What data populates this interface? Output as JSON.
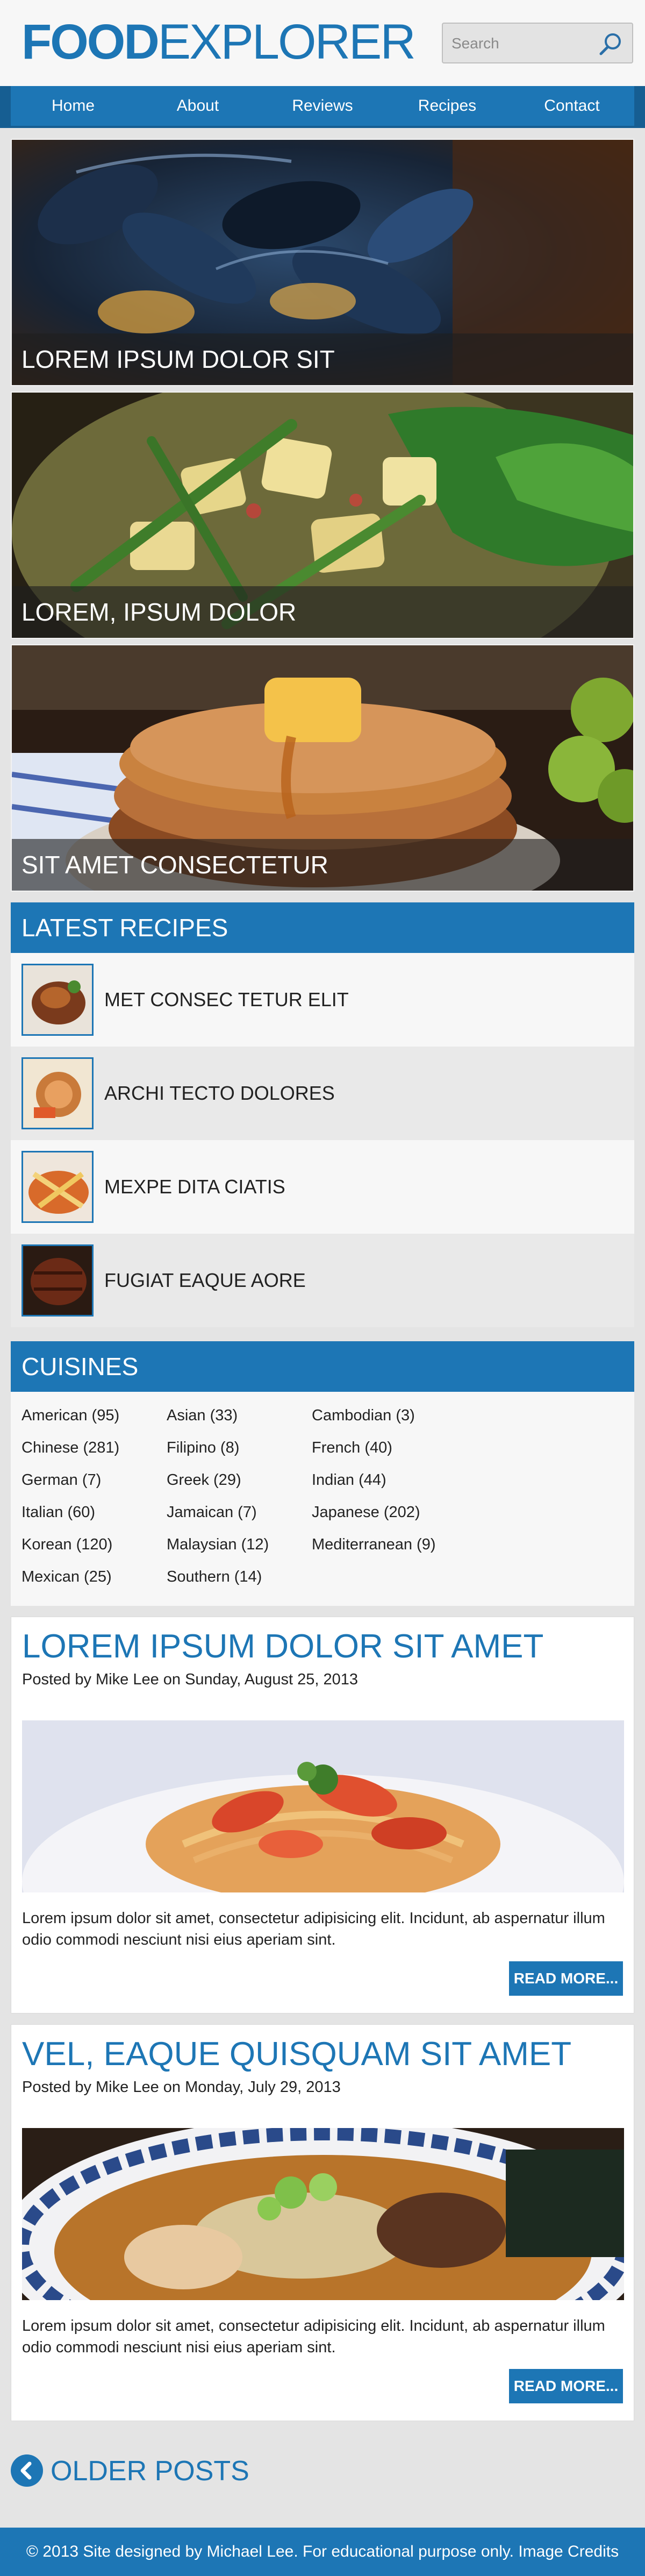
{
  "header": {
    "logo_bold": "FOOD",
    "logo_rest": "EXPLORER",
    "search_placeholder": "Search"
  },
  "nav": [
    {
      "label": "Home"
    },
    {
      "label": "About"
    },
    {
      "label": "Reviews"
    },
    {
      "label": "Recipes"
    },
    {
      "label": "Contact"
    }
  ],
  "features": [
    {
      "caption": "LOREM IPSUM DOLOR SIT",
      "image": "mussels"
    },
    {
      "caption": "LOREM, IPSUM DOLOR",
      "image": "potato-salad"
    },
    {
      "caption": "SIT AMET CONSECTETUR",
      "image": "pancakes"
    }
  ],
  "latest_recipes": {
    "heading": "LATEST RECIPES",
    "items": [
      {
        "label": "MET CONSEC TETUR ELIT"
      },
      {
        "label": "ARCHI TECTO DOLORES"
      },
      {
        "label": "MEXPE DITA CIATIS"
      },
      {
        "label": "FUGIAT EAQUE AORE"
      }
    ]
  },
  "cuisines": {
    "heading": "CUISINES",
    "items": [
      "American (95)",
      "Asian (33)",
      "Cambodian (3)",
      "Chinese (281)",
      "Filipino (8)",
      "French (40)",
      "German (7)",
      "Greek (29)",
      "Indian (44)",
      "Italian (60)",
      "Jamaican (7)",
      "Japanese (202)",
      "Korean (120)",
      "Malaysian (12)",
      "Mediterranean (9)",
      "Mexican (25)",
      "Southern (14)"
    ]
  },
  "posts": [
    {
      "title": "LOREM IPSUM DOLOR SIT AMET",
      "meta": "Posted by Mike Lee on Sunday, August 25, 2013",
      "image": "shrimp-pasta",
      "excerpt": "Lorem ipsum dolor sit amet, consectetur adipisicing elit. Incidunt, ab aspernatur illum odio commodi nesciunt nisi eius aperiam sint.",
      "more_label": "READ MORE..."
    },
    {
      "title": "VEL, EAQUE QUISQUAM SIT AMET",
      "meta": "Posted by Mike Lee on Monday, July 29, 2013",
      "image": "ramen",
      "excerpt": "Lorem ipsum dolor sit amet, consectetur adipisicing elit. Incidunt, ab aspernatur illum odio commodi nesciunt nisi eius aperiam sint.",
      "more_label": "READ MORE..."
    }
  ],
  "older_posts": {
    "label": "OLDER POSTS",
    "icon": "chevron-left-icon"
  },
  "footer": {
    "text": "© 2013 Site designed by Michael Lee. For educational purpose only. Image Credits"
  },
  "colors": {
    "brand_blue": "#1d76b5",
    "background": "#e4e4e4"
  }
}
